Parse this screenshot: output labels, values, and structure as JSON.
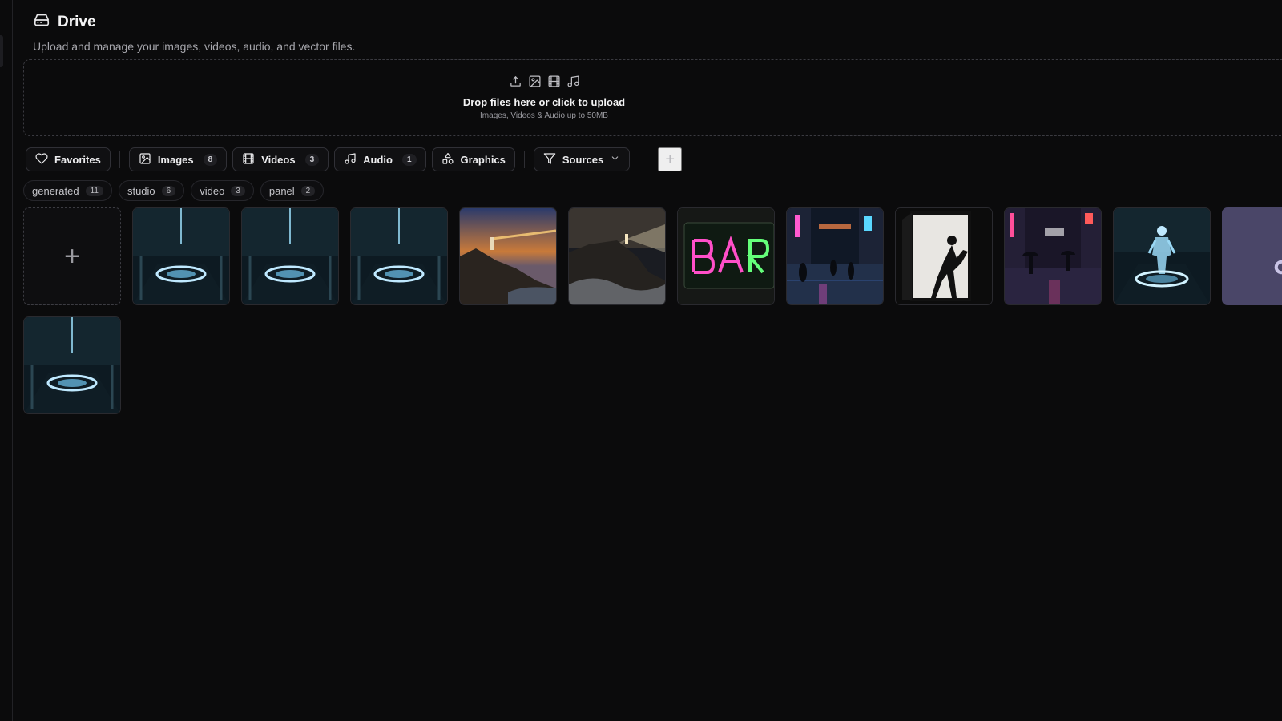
{
  "header": {
    "title": "Drive",
    "subtitle": "Upload and manage your images, videos, audio, and vector files."
  },
  "dropzone": {
    "title": "Drop files here or click to upload",
    "subtitle": "Images, Videos & Audio up to 50MB",
    "icons": [
      "upload-icon",
      "image-icon",
      "film-icon",
      "music-icon"
    ]
  },
  "filters": {
    "favorites": {
      "label": "Favorites",
      "icon": "heart-icon"
    },
    "images": {
      "label": "Images",
      "count": "8",
      "icon": "image-icon"
    },
    "videos": {
      "label": "Videos",
      "count": "3",
      "icon": "film-icon"
    },
    "audio": {
      "label": "Audio",
      "count": "1",
      "icon": "music-icon"
    },
    "graphics": {
      "label": "Graphics",
      "icon": "shapes-icon"
    },
    "sources": {
      "label": "Sources",
      "icon": "filter-icon"
    },
    "add_label": "+"
  },
  "tags": [
    {
      "label": "generated",
      "count": "11"
    },
    {
      "label": "studio",
      "count": "6"
    },
    {
      "label": "video",
      "count": "3"
    },
    {
      "label": "panel",
      "count": "2"
    }
  ],
  "grid": {
    "add_label": "+",
    "tiles": [
      {
        "kind": "image",
        "subject": "holographic stage studio"
      },
      {
        "kind": "image",
        "subject": "holographic stage studio"
      },
      {
        "kind": "image",
        "subject": "holographic stage studio"
      },
      {
        "kind": "image",
        "subject": "lighthouse cliff at sunset"
      },
      {
        "kind": "image",
        "subject": "lighthouse beam over waves"
      },
      {
        "kind": "image",
        "subject": "neon BAR sign"
      },
      {
        "kind": "image",
        "subject": "rainy neon street"
      },
      {
        "kind": "image",
        "subject": "silhouette in bright doorway"
      },
      {
        "kind": "image",
        "subject": "rainy neon street with umbrellas"
      },
      {
        "kind": "image",
        "subject": "hologram figure on stage"
      },
      {
        "kind": "audio",
        "subject": "audio file"
      },
      {
        "kind": "image",
        "subject": "holographic stage studio"
      }
    ]
  },
  "colors": {
    "background": "#0b0b0c",
    "border": "#303036",
    "audio_tile": "#4a4668"
  }
}
